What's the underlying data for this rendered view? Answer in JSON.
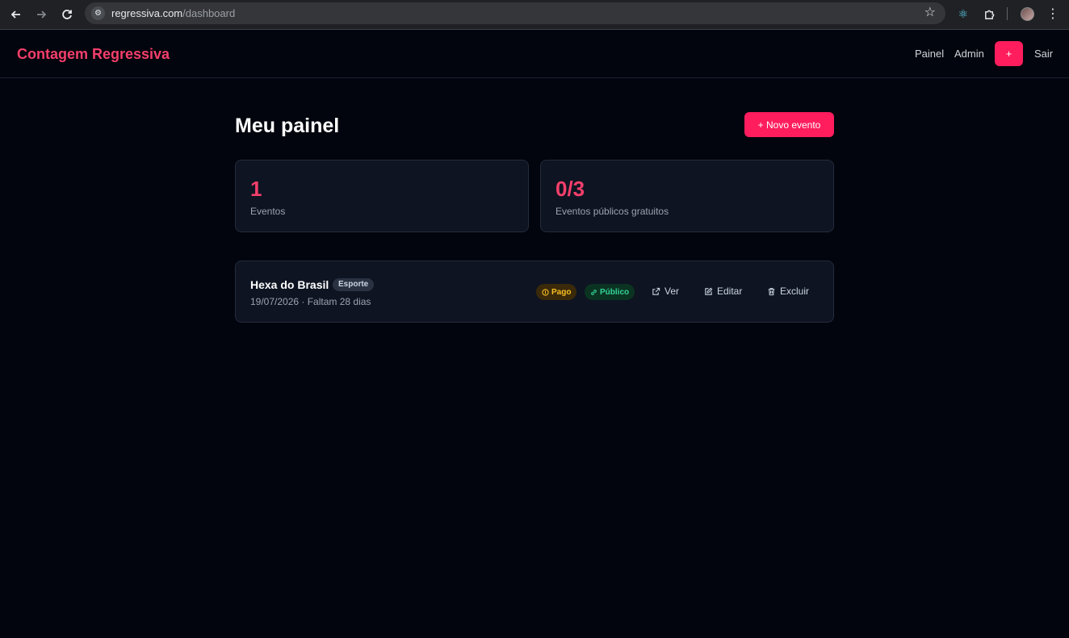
{
  "browser": {
    "url_host": "regressiva.com",
    "url_path": "/dashboard",
    "icons": [
      "back-arrow-icon",
      "forward-arrow-icon",
      "reload-icon",
      "site-settings-icon",
      "star-icon",
      "react-devtools-icon",
      "extensions-icon",
      "profile-avatar",
      "menu-icon"
    ]
  },
  "header": {
    "brand": "Contagem Regressiva",
    "nav": {
      "painel": "Painel",
      "admin": "Admin",
      "plus": "+",
      "sair": "Sair"
    }
  },
  "main": {
    "title": "Meu painel",
    "new_event_label": "+ Novo evento",
    "stats": [
      {
        "value": "1",
        "label": "Eventos"
      },
      {
        "value": "0/3",
        "label": "Eventos públicos gratuitos"
      }
    ],
    "events": [
      {
        "title": "Hexa do Brasil",
        "category": "Esporte",
        "date_line": "19/07/2026 · Faltam 28 dias",
        "badges": {
          "paid": "Pago",
          "public": "Público"
        },
        "actions": {
          "view": "Ver",
          "edit": "Editar",
          "delete": "Excluir"
        }
      }
    ]
  },
  "colors": {
    "accent": "#ff1d5e",
    "brand_text": "#f43f6b",
    "background": "#02050d",
    "card": "#0e1422",
    "paid_badge": "#fbbf24",
    "public_badge": "#34d399"
  }
}
